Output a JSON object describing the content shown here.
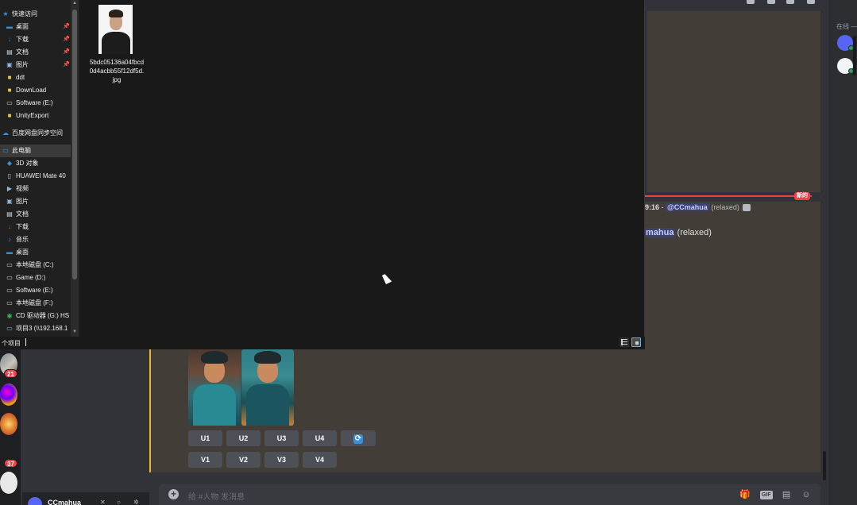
{
  "explorer": {
    "nav_items": [
      {
        "label": "快速访问",
        "icon": "star-icon",
        "pinned": false,
        "indent": 0
      },
      {
        "label": "桌面",
        "icon": "desktop-folder-icon",
        "pinned": true,
        "indent": 1
      },
      {
        "label": "下载",
        "icon": "download-arrow-icon",
        "pinned": true,
        "indent": 1
      },
      {
        "label": "文档",
        "icon": "document-icon",
        "pinned": true,
        "indent": 1
      },
      {
        "label": "图片",
        "icon": "pictures-icon",
        "pinned": true,
        "indent": 1
      },
      {
        "label": "ddt",
        "icon": "folder-icon",
        "pinned": false,
        "indent": 1
      },
      {
        "label": "DownLoad",
        "icon": "folder-icon",
        "pinned": false,
        "indent": 1
      },
      {
        "label": "Software (E:)",
        "icon": "drive-icon",
        "pinned": false,
        "indent": 1
      },
      {
        "label": "UnityExport",
        "icon": "folder-icon",
        "pinned": false,
        "indent": 1
      },
      {
        "label": "百度网盘同步空间",
        "icon": "cloud-sync-icon",
        "pinned": false,
        "indent": 0
      },
      {
        "label": "此电脑",
        "icon": "computer-icon",
        "pinned": false,
        "indent": 0
      },
      {
        "label": "3D 对象",
        "icon": "cube-icon",
        "pinned": false,
        "indent": 1
      },
      {
        "label": "HUAWEI Mate 40",
        "icon": "phone-icon",
        "pinned": false,
        "indent": 1
      },
      {
        "label": "视频",
        "icon": "video-icon",
        "pinned": false,
        "indent": 1
      },
      {
        "label": "图片",
        "icon": "pictures-icon",
        "pinned": false,
        "indent": 1
      },
      {
        "label": "文档",
        "icon": "document-icon",
        "pinned": false,
        "indent": 1
      },
      {
        "label": "下载",
        "icon": "download-arrow-icon",
        "pinned": false,
        "indent": 1
      },
      {
        "label": "音乐",
        "icon": "music-note-icon",
        "pinned": false,
        "indent": 1
      },
      {
        "label": "桌面",
        "icon": "desktop-folder-icon",
        "pinned": false,
        "indent": 1
      },
      {
        "label": "本地磁盘 (C:)",
        "icon": "drive-icon",
        "pinned": false,
        "indent": 1
      },
      {
        "label": "Game (D:)",
        "icon": "drive-icon",
        "pinned": false,
        "indent": 1
      },
      {
        "label": "Software (E:)",
        "icon": "drive-icon",
        "pinned": false,
        "indent": 1
      },
      {
        "label": "本地磁盘 (F:)",
        "icon": "drive-icon",
        "pinned": false,
        "indent": 1
      },
      {
        "label": "CD 驱动器 (G:) HS",
        "icon": "cd-drive-icon",
        "pinned": false,
        "indent": 1
      },
      {
        "label": "项目3 (\\\\192.168.1",
        "icon": "network-drive-icon",
        "pinned": false,
        "indent": 1
      }
    ],
    "file": {
      "name": "5bdc05136a04fbcd0d4acbb55f12df5d.jpg"
    },
    "status_text": "个项目"
  },
  "discord": {
    "message": {
      "time": "9:16",
      "separator": " - ",
      "mention": "@CCmahua",
      "mode": "(relaxed)",
      "line2_mention": "mahua",
      "line2_mode": "(relaxed)"
    },
    "new_label": "新的",
    "buttons_upscale": [
      "U1",
      "U2",
      "U3",
      "U4"
    ],
    "buttons_variation": [
      "V1",
      "V2",
      "V3",
      "V4"
    ],
    "input_placeholder": "给 #人物 发消息",
    "gif_label": "GIF",
    "member_header": "在线 —",
    "user_name": "CCmahua",
    "server_badges": [
      "21",
      "37"
    ]
  },
  "colors": {
    "accent": "#f0b232",
    "new_red": "#f23f43",
    "mention_bg": "#3c4270",
    "panel_bg": "#423e37"
  }
}
